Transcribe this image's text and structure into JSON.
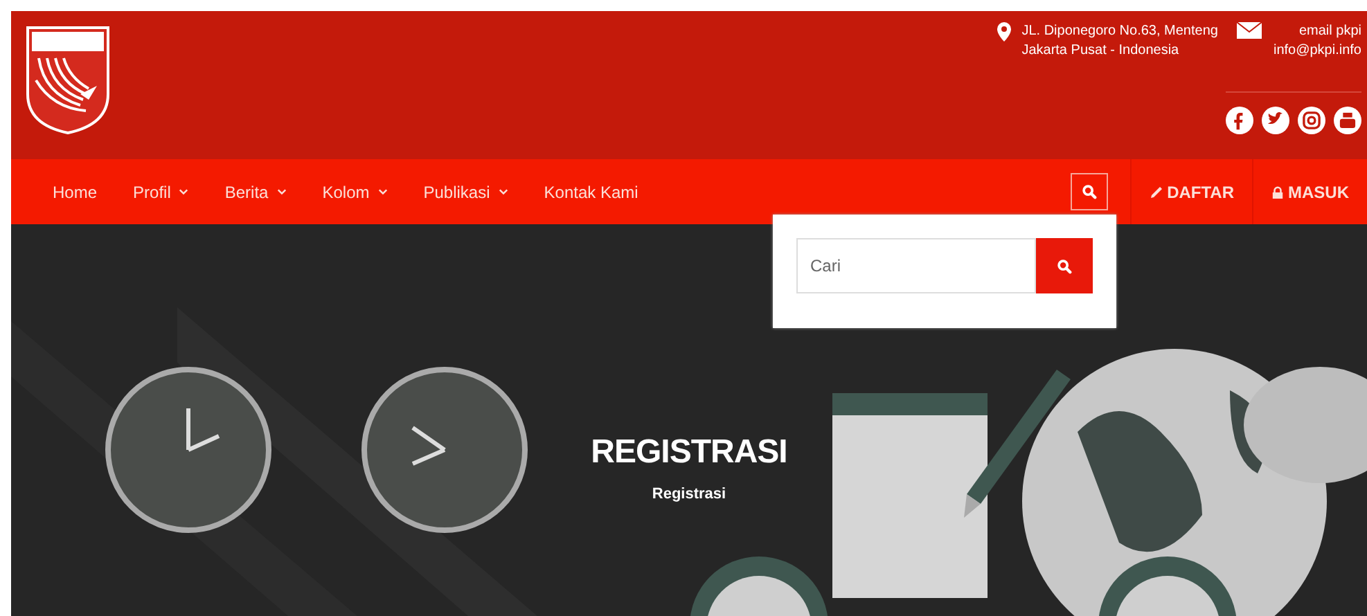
{
  "header": {
    "address": [
      "JL. Diponegoro No.63, Menteng",
      "Jakarta Pusat - Indonesia"
    ],
    "email": [
      "email pkpi",
      "info@pkpi.info"
    ],
    "social": [
      {
        "kind": "facebook"
      },
      {
        "kind": "twitter"
      },
      {
        "kind": "instagram"
      },
      {
        "kind": "youtube"
      }
    ]
  },
  "nav": {
    "items": [
      {
        "label": "Home",
        "has_dropdown": false
      },
      {
        "label": "Profil",
        "has_dropdown": true
      },
      {
        "label": "Berita",
        "has_dropdown": true
      },
      {
        "label": "Kolom",
        "has_dropdown": true
      },
      {
        "label": "Publikasi",
        "has_dropdown": true
      },
      {
        "label": "Kontak Kami",
        "has_dropdown": false
      }
    ],
    "actions": [
      {
        "label": "DAFTAR",
        "kind": "pencil"
      },
      {
        "label": "MASUK",
        "kind": "lock"
      }
    ]
  },
  "search": {
    "expanded": true,
    "placeholder": "Cari"
  },
  "hero": {
    "title": "REGISTRASI",
    "breadcrumb": "Registrasi"
  }
}
